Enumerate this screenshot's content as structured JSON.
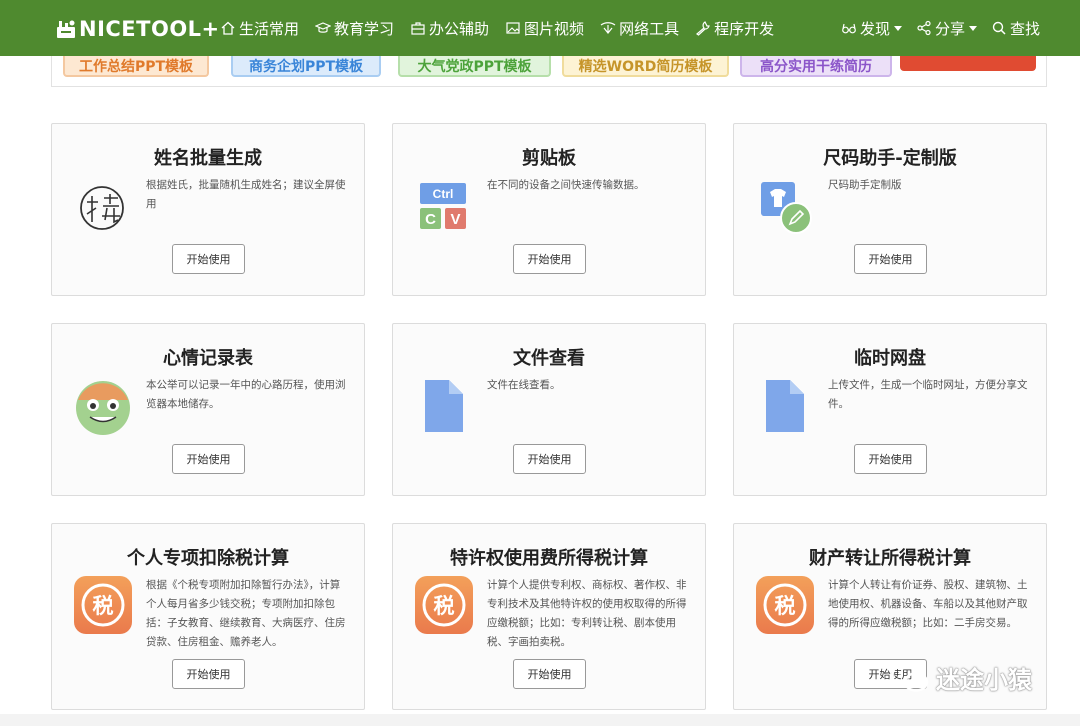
{
  "nav": {
    "logo_text": "NICETOOL+",
    "items": [
      {
        "label": "生活常用",
        "icon": "home-icon"
      },
      {
        "label": "教育学习",
        "icon": "graduation-cap-icon"
      },
      {
        "label": "办公辅助",
        "icon": "briefcase-icon"
      },
      {
        "label": "图片视频",
        "icon": "image-icon"
      },
      {
        "label": "网络工具",
        "icon": "network-icon"
      },
      {
        "label": "程序开发",
        "icon": "wrench-icon"
      }
    ],
    "right": [
      {
        "label": "发现",
        "icon": "glasses-icon"
      },
      {
        "label": "分享",
        "icon": "share-icon"
      },
      {
        "label": "查找",
        "icon": "search-icon"
      }
    ],
    "color": "#4f8a2f"
  },
  "banner": {
    "tags": [
      "工作总结PPT模板",
      "商务企划PPT模板",
      "大气党政PPT模板",
      "精选WORD简历模板",
      "高分实用干练简历"
    ]
  },
  "cards": [
    {
      "title": "姓名批量生成",
      "desc": "根据姓氏，批量随机生成姓名；建议全屏使用",
      "button": "开始使用",
      "icon": "name-seal-icon"
    },
    {
      "title": "剪贴板",
      "desc": "在不同的设备之间快速传输数据。",
      "button": "开始使用",
      "icon": "clipboard-ctrl-cv-icon",
      "icon_text": [
        "Ctrl",
        "C",
        "V"
      ]
    },
    {
      "title": "尺码助手-定制版",
      "desc": "尺码助手定制版",
      "button": "开始使用",
      "icon": "tshirt-edit-icon"
    },
    {
      "title": "心情记录表",
      "desc": "本公举可以记录一年中的心路历程，使用浏览器本地储存。",
      "button": "开始使用",
      "icon": "smiley-face-icon"
    },
    {
      "title": "文件查看",
      "desc": "文件在线查看。",
      "button": "开始使用",
      "icon": "file-icon"
    },
    {
      "title": "临时网盘",
      "desc": "上传文件，生成一个临时网址，方便分享文件。",
      "button": "开始使用",
      "icon": "file-icon"
    },
    {
      "title": "个人专项扣除税计算",
      "desc": "根据《个税专项附加扣除暂行办法》，计算个人每月省多少钱交税；专项附加扣除包括：子女教育、继续教育、大病医疗、住房贷款、住房租金、赡养老人。",
      "button": "开始使用",
      "icon": "tax-icon",
      "icon_text": "税"
    },
    {
      "title": "特许权使用费所得税计算",
      "desc": "计算个人提供专利权、商标权、著作权、非专利技术及其他特许权的使用权取得的所得应缴税额；比如：专利转让税、剧本使用税、字画拍卖税。",
      "button": "开始使用",
      "icon": "tax-icon",
      "icon_text": "税"
    },
    {
      "title": "财产转让所得税计算",
      "desc": "计算个人转让有价证券、股权、建筑物、土地使用权、机器设备、车船以及其他财产取得的所得应缴税额；比如：二手房交易。",
      "button": "开始使用",
      "icon": "tax-icon",
      "icon_text": "税"
    }
  ],
  "watermark": "迷途小猿"
}
